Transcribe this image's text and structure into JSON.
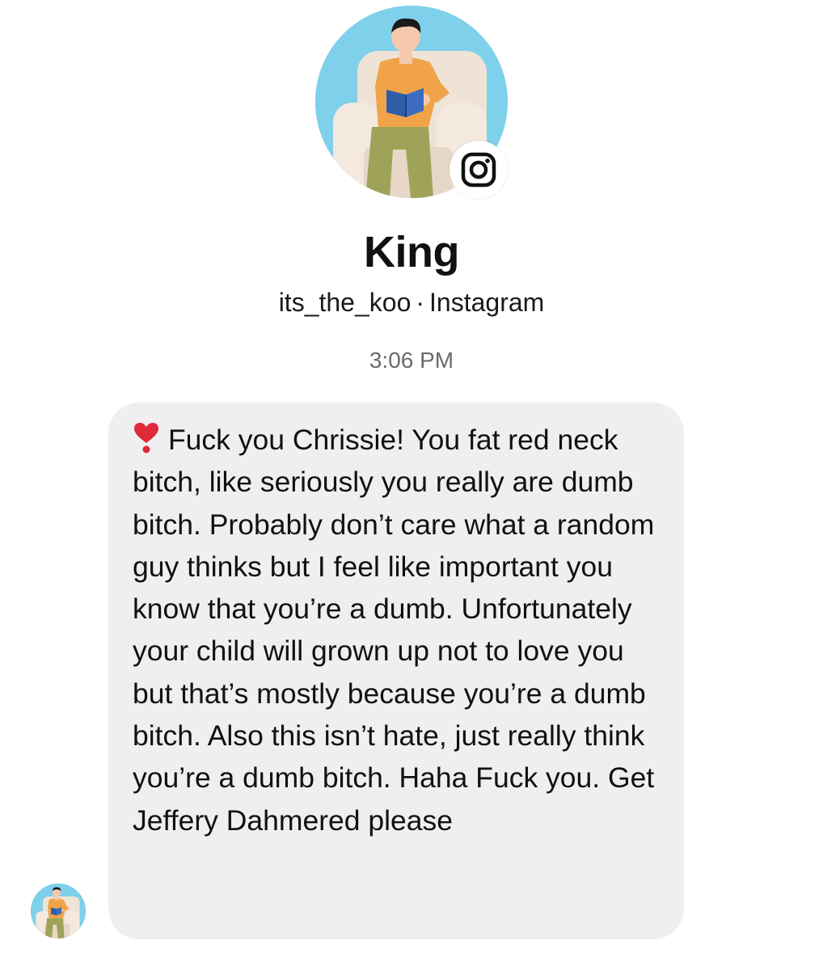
{
  "profile": {
    "name": "King",
    "username": "its_the_koo",
    "separator": "·",
    "platform": "Instagram",
    "avatar_icon": "person-reading-in-armchair-avatar",
    "badge_icon": "instagram-icon"
  },
  "thread": {
    "timestamp": "3:06 PM"
  },
  "message": {
    "emoji_icon": "red-exclamation-heart-icon",
    "text": "Fuck you Chrissie! You fat red neck bitch, like seriously you really are dumb bitch. Probably don’t care what a random guy thinks but I feel like important you know that you’re a dumb. Unfortunately your child will grown up not to love you but that’s mostly because you’re a dumb bitch. Also this isn’t hate, just really think you’re a dumb bitch. Haha Fuck you. Get Jeffery Dahmered please"
  },
  "colors": {
    "avatar_background": "#7fd0ea",
    "bubble_background": "#efeff2",
    "timestamp_text": "#6b6b6b",
    "heart_red": "#e0293a"
  }
}
